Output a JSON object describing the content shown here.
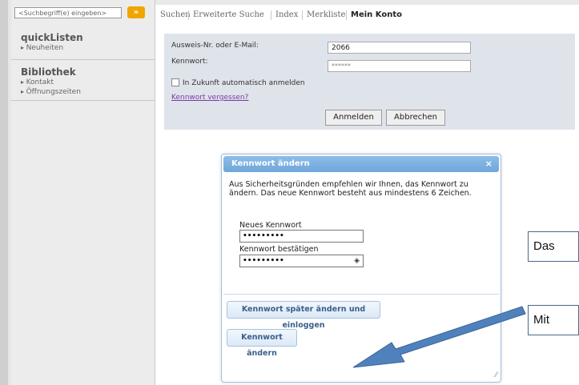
{
  "search": {
    "placeholder": "<Suchbegriff(e) eingeben>",
    "button_label": "»"
  },
  "sidebar": {
    "sections": [
      {
        "title": "quickListen",
        "items": [
          "Neuheiten"
        ]
      },
      {
        "title": "Bibliothek",
        "items": [
          "Kontakt",
          "Öffnungszeiten"
        ]
      }
    ]
  },
  "nav": {
    "tabs": [
      "Suchen",
      "Erweiterte Suche",
      "Index",
      "Merkliste",
      "Mein Konto"
    ],
    "active": "Mein Konto"
  },
  "login": {
    "id_label": "Ausweis-Nr. oder E-Mail:",
    "id_value": "2066",
    "pw_label": "Kennwort:",
    "pw_value": "******",
    "remember_label": "In Zukunft automatisch anmelden",
    "forgot_link": "Kennwort vergessen?",
    "login_button": "Anmelden",
    "cancel_button": "Abbrechen"
  },
  "dialog": {
    "title": "Kennwort ändern",
    "close": "×",
    "text": "Aus Sicherheitsgründen empfehlen wir Ihnen, das Kennwort zu ändern. Das neue Kennwort besteht aus mindestens 6 Zeichen.",
    "new_pw_label": "Neues Kennwort",
    "new_pw_value": "•••••••••",
    "confirm_pw_label": "Kennwort bestätigen",
    "confirm_pw_value": "•••••••••",
    "later_button": "Kennwort später ändern und einloggen",
    "change_button": "Kennwort ändern"
  },
  "callouts": [
    "Das",
    "Mit"
  ],
  "colors": {
    "accent": "#6ea6da",
    "search_button": "#f0a500",
    "arrow": "#4f81bd"
  }
}
